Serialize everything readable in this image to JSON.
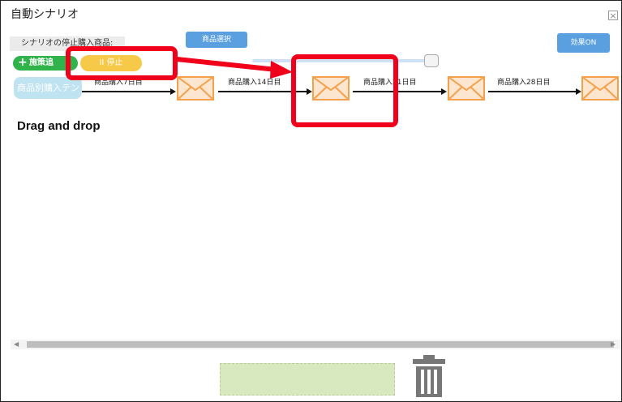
{
  "window": {
    "title": "自動シナリオ",
    "close_symbol": "×"
  },
  "toolbar": {
    "stop_product_label": "シナリオの停止購入商品:",
    "select_product_button": "商品選択",
    "effect_on_button": "効果ON",
    "add_action_button": "施策追",
    "pause_button": "II 停止"
  },
  "flow": {
    "start_node": "商品別購入テン",
    "edges": [
      "商品購入7日目",
      "商品購入14日目",
      "商品購入21日目",
      "商品購入28日目"
    ],
    "mail_icon_count": 4
  },
  "annotation": {
    "drag_text": "Drag and drop"
  },
  "colors": {
    "accent_red": "#f0001a",
    "mail_orange": "#f5a04a",
    "button_blue": "#5aa0e0",
    "button_green": "#2fb34a",
    "button_yellow": "#f7c948"
  }
}
